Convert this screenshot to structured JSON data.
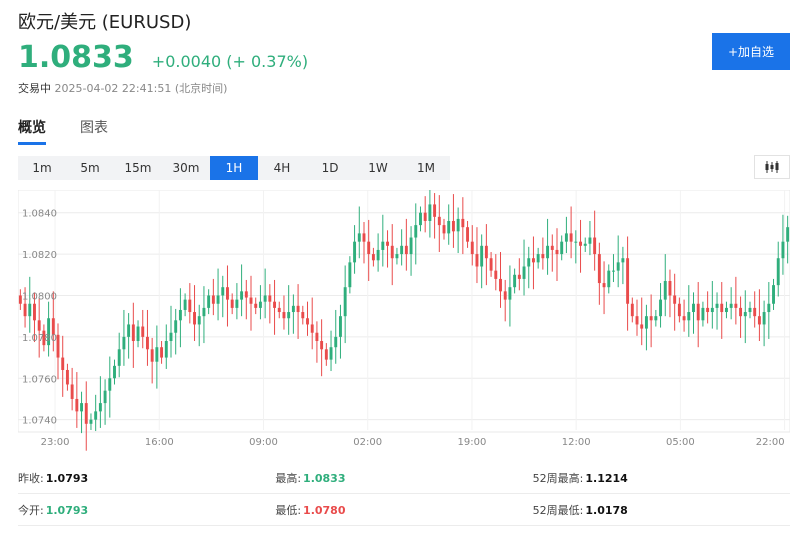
{
  "header": {
    "title": "欧元/美元 (EURUSD)",
    "price": "1.0833",
    "change": "+0.0040 (+ 0.37%)",
    "status": "交易中",
    "timestamp": "2025-04-02 22:41:51 (北京时间)"
  },
  "add_button": {
    "label": "+加自选"
  },
  "tabs": [
    {
      "label": "概览"
    },
    {
      "label": "图表"
    }
  ],
  "intervals": [
    {
      "label": "1m"
    },
    {
      "label": "5m"
    },
    {
      "label": "15m"
    },
    {
      "label": "30m"
    },
    {
      "label": "1H"
    },
    {
      "label": "4H"
    },
    {
      "label": "1D"
    },
    {
      "label": "1W"
    },
    {
      "label": "1M"
    }
  ],
  "active_interval": "1H",
  "colors": {
    "up": "#2fae7c",
    "down": "#e94b4b",
    "accent": "#1a73e8"
  },
  "icons": {
    "chart_type": "candlestick-icon"
  },
  "stats": [
    [
      {
        "label": "昨收:",
        "value": "1.0793",
        "color": "black"
      },
      {
        "label": "最高:",
        "value": "1.0833",
        "color": "green"
      },
      {
        "label": "52周最高:",
        "value": "1.1214",
        "color": "black"
      }
    ],
    [
      {
        "label": "今开:",
        "value": "1.0793",
        "color": "green"
      },
      {
        "label": "最低:",
        "value": "1.0780",
        "color": "red"
      },
      {
        "label": "52周最低:",
        "value": "1.0178",
        "color": "black"
      }
    ]
  ],
  "chart_data": {
    "type": "candlestick",
    "ylim": [
      1.0735,
      1.085
    ],
    "y_ticks": [
      "1.0840",
      "1.0820",
      "1.0800",
      "1.0780",
      "1.0760",
      "1.0740"
    ],
    "y_tick_values": [
      1.084,
      1.082,
      1.08,
      1.078,
      1.076,
      1.074
    ],
    "x_ticks": [
      "23:00",
      "16:00",
      "09:00",
      "02:00",
      "19:00",
      "12:00",
      "05:00",
      "22:00"
    ],
    "grid": true,
    "close": [
      1.0796,
      1.079,
      1.0796,
      1.0788,
      1.0783,
      1.0776,
      1.0789,
      1.0781,
      1.077,
      1.0764,
      1.0757,
      1.075,
      1.0744,
      1.0748,
      1.0738,
      1.074,
      1.0744,
      1.0748,
      1.0754,
      1.076,
      1.0766,
      1.0774,
      1.078,
      1.0786,
      1.0778,
      1.0785,
      1.078,
      1.0774,
      1.0768,
      1.0775,
      1.077,
      1.0778,
      1.0782,
      1.0788,
      1.0793,
      1.0798,
      1.0792,
      1.0786,
      1.079,
      1.0794,
      1.08,
      1.0796,
      1.08,
      1.0804,
      1.0798,
      1.0794,
      1.0798,
      1.0802,
      1.0799,
      1.0796,
      1.0794,
      1.0797,
      1.08,
      1.0797,
      1.0794,
      1.0792,
      1.0789,
      1.0792,
      1.0795,
      1.0792,
      1.0789,
      1.0786,
      1.0782,
      1.0778,
      1.0774,
      1.0769,
      1.0775,
      1.078,
      1.079,
      1.0804,
      1.0816,
      1.0826,
      1.083,
      1.0826,
      1.082,
      1.0817,
      1.0822,
      1.0826,
      1.0824,
      1.0818,
      1.082,
      1.0824,
      1.082,
      1.0828,
      1.0834,
      1.084,
      1.0836,
      1.0844,
      1.0838,
      1.0834,
      1.083,
      1.0836,
      1.0831,
      1.0837,
      1.0833,
      1.0826,
      1.082,
      1.0814,
      1.0824,
      1.0818,
      1.0812,
      1.0808,
      1.0802,
      1.0798,
      1.0804,
      1.081,
      1.0808,
      1.0814,
      1.0818,
      1.0816,
      1.082,
      1.0818,
      1.0824,
      1.0822,
      1.082,
      1.0826,
      1.083,
      1.0826,
      1.0826,
      1.0824,
      1.0825,
      1.0828,
      1.082,
      1.0806,
      1.0804,
      1.0812,
      1.0812,
      1.0816,
      1.0818,
      1.0796,
      1.079,
      1.0786,
      1.0784,
      1.079,
      1.0788,
      1.079,
      1.0798,
      1.0807,
      1.08,
      1.0796,
      1.079,
      1.0788,
      1.0792,
      1.0796,
      1.0788,
      1.0794,
      1.0792,
      1.0794,
      1.0796,
      1.0792,
      1.0794,
      1.0796,
      1.0794,
      1.079,
      1.0792,
      1.0794,
      1.079,
      1.0786,
      1.0792,
      1.0796,
      1.0805,
      1.0818,
      1.0826,
      1.0833
    ]
  }
}
